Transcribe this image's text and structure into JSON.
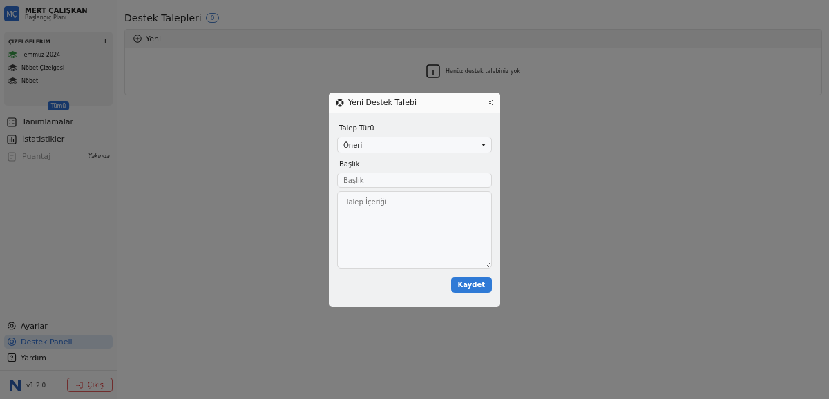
{
  "user": {
    "initials": "MÇ",
    "name": "MERT ÇALIŞKAN",
    "plan": "Başlangıç Planı"
  },
  "charts_panel": {
    "title": "ÇİZELGELERİM",
    "add": "+",
    "all_button": "Tümü",
    "items": [
      {
        "label": "Temmuz 2024",
        "color": "#1d4d24"
      },
      {
        "label": "Nöbet Çizelgesi",
        "color": "#1f1f1f"
      },
      {
        "label": "Nöbet",
        "color": "#1f1f1f"
      }
    ]
  },
  "menu": [
    {
      "label": "Tanımlamalar",
      "disabled": false
    },
    {
      "label": "İstatistikler",
      "disabled": false
    },
    {
      "label": "Puantaj",
      "disabled": true,
      "badge": "Yakında"
    }
  ],
  "bottom_menu": [
    {
      "label": "Ayarlar",
      "selected": false
    },
    {
      "label": "Destek Paneli",
      "selected": true
    },
    {
      "label": "Yardım",
      "selected": false
    }
  ],
  "footer": {
    "version": "v1.2.0",
    "logout": "Çıkış"
  },
  "page": {
    "title": "Destek Talepleri",
    "count": "0",
    "new_button": "Yeni",
    "empty_message": "Henüz destek talebiniz yok"
  },
  "modal": {
    "title": "Yeni Destek Talebi",
    "fields": [
      {
        "kind": "select",
        "label": "Talep Türü",
        "value": "Öneri"
      },
      {
        "kind": "text",
        "label": "Başlık",
        "placeholder": "Başlık"
      },
      {
        "kind": "textarea",
        "placeholder": "Talep İçeriği"
      }
    ],
    "save_button": "Kaydet"
  }
}
